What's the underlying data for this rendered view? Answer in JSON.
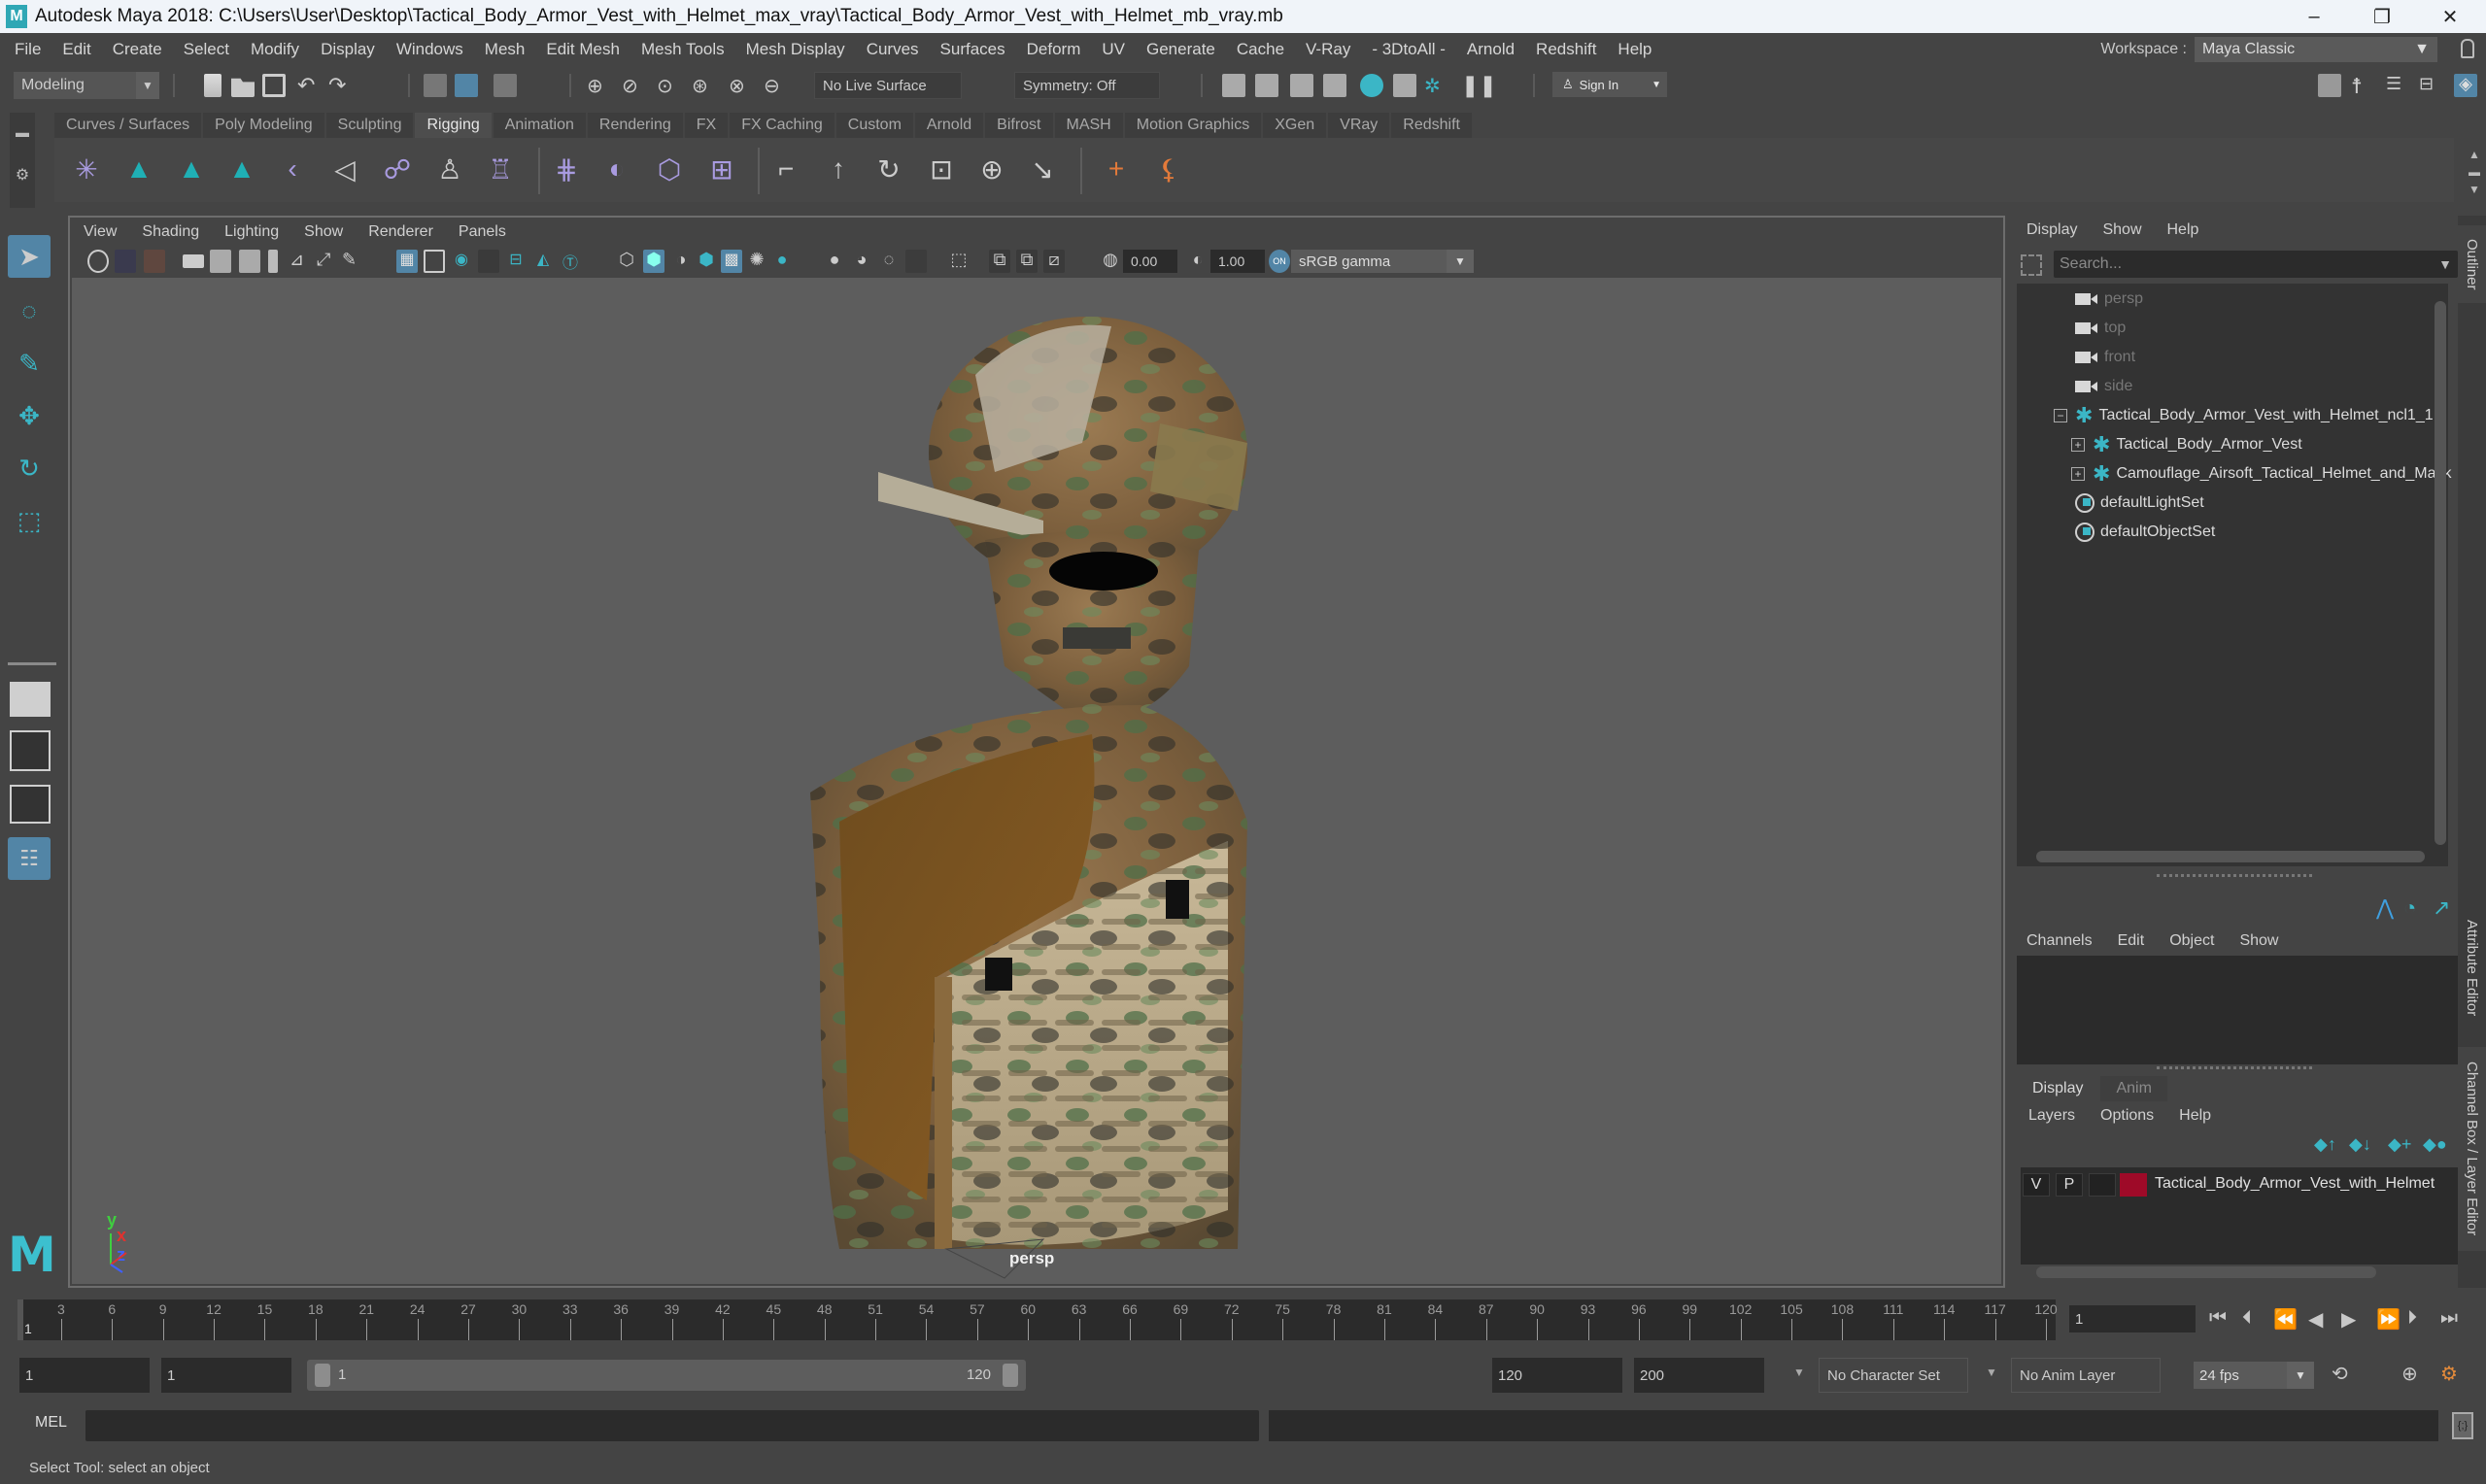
{
  "window": {
    "title": "Autodesk Maya 2018: C:\\Users\\User\\Desktop\\Tactical_Body_Armor_Vest_with_Helmet_max_vray\\Tactical_Body_Armor_Vest_with_Helmet_mb_vray.mb",
    "logo": "M",
    "minimize": "–",
    "restore": "❐",
    "close": "✕"
  },
  "menubar": {
    "items": [
      "File",
      "Edit",
      "Create",
      "Select",
      "Modify",
      "Display",
      "Windows",
      "Mesh",
      "Edit Mesh",
      "Mesh Tools",
      "Mesh Display",
      "Curves",
      "Surfaces",
      "Deform",
      "UV",
      "Generate",
      "Cache",
      "V-Ray",
      "- 3DtoAll -",
      "Arnold",
      "Redshift",
      "Help"
    ],
    "workspace_label": "Workspace :",
    "workspace_value": "Maya Classic"
  },
  "statusline": {
    "mode": "Modeling",
    "live_surface": "No Live Surface",
    "symmetry": "Symmetry: Off",
    "sign_in": "Sign In"
  },
  "shelf": {
    "tabs": [
      "Curves / Surfaces",
      "Poly Modeling",
      "Sculpting",
      "Rigging",
      "Animation",
      "Rendering",
      "FX",
      "FX Caching",
      "Custom",
      "Arnold",
      "Bifrost",
      "MASH",
      "Motion Graphics",
      "XGen",
      "VRay",
      "Redshift"
    ],
    "active_tab": "Rigging"
  },
  "viewport": {
    "menu": [
      "View",
      "Shading",
      "Lighting",
      "Show",
      "Renderer",
      "Panels"
    ],
    "exposure": "0.00",
    "gamma": "1.00",
    "color_space": "sRGB gamma",
    "camera": "persp",
    "axes": {
      "x": "x",
      "y": "y",
      "z": "z"
    },
    "colors": {
      "axis_x": "#e0322f",
      "axis_y": "#3fcf3f",
      "axis_z": "#3f5fff",
      "background": "#5d5d5d"
    }
  },
  "outliner": {
    "menu": [
      "Display",
      "Show",
      "Help"
    ],
    "search_placeholder": "Search...",
    "items": [
      {
        "label": "persp",
        "type": "camera",
        "dim": true
      },
      {
        "label": "top",
        "type": "camera",
        "dim": true
      },
      {
        "label": "front",
        "type": "camera",
        "dim": true
      },
      {
        "label": "side",
        "type": "camera",
        "dim": true
      },
      {
        "label": "Tactical_Body_Armor_Vest_with_Helmet_ncl1_1",
        "type": "transform",
        "expander": "−"
      },
      {
        "label": "Tactical_Body_Armor_Vest",
        "type": "transform",
        "expander": "+"
      },
      {
        "label": "Camouflage_Airsoft_Tactical_Helmet_and_Mask",
        "type": "transform",
        "expander": "+"
      },
      {
        "label": "defaultLightSet",
        "type": "set"
      },
      {
        "label": "defaultObjectSet",
        "type": "set"
      }
    ]
  },
  "channelbox": {
    "menu": [
      "Channels",
      "Edit",
      "Object",
      "Show"
    ]
  },
  "layereditor": {
    "tabs": [
      "Display",
      "Anim"
    ],
    "active_tab": "Display",
    "menu": [
      "Layers",
      "Options",
      "Help"
    ],
    "layers": [
      {
        "visible": "V",
        "playback": "P",
        "color": "#9e0a28",
        "name": "Tactical_Body_Armor_Vest_with_Helmet"
      }
    ]
  },
  "side_tabs": [
    "Outliner",
    "Attribute Editor",
    "Channel Box / Layer Editor"
  ],
  "timeline": {
    "start": 1,
    "end": 120,
    "tick_labels": [
      3,
      6,
      9,
      12,
      15,
      18,
      21,
      24,
      27,
      30,
      33,
      36,
      39,
      42,
      45,
      48,
      51,
      54,
      57,
      60,
      63,
      66,
      69,
      72,
      75,
      78,
      81,
      84,
      87,
      90,
      93,
      96,
      99,
      102,
      105,
      108,
      111,
      114,
      117,
      120
    ],
    "current_frame_label": "1",
    "current_frame": "1"
  },
  "range": {
    "start_time": "1",
    "playback_start": "1",
    "slider_start": "1",
    "slider_end": "120",
    "playback_end": "120",
    "end_time": "200",
    "character_set": "No Character Set",
    "anim_layer": "No Anim Layer",
    "fps": "24 fps"
  },
  "command_line": {
    "label": "MEL"
  },
  "help_line": {
    "text": "Select Tool: select an object"
  }
}
